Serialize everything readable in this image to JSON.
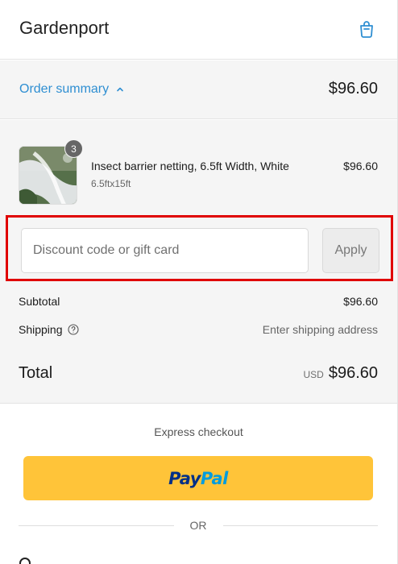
{
  "header": {
    "brand": "Gardenport",
    "cart_icon": "shopping-bag-icon"
  },
  "summary": {
    "toggle_label": "Order summary",
    "toggle_icon": "chevron-up-icon",
    "total": "$96.60"
  },
  "item": {
    "name": "Insect barrier netting, 6.5ft Width, White",
    "variant": "6.5ftx15ft",
    "price": "$96.60",
    "quantity": "3",
    "image_icon": "product-thumbnail"
  },
  "discount": {
    "placeholder": "Discount code or gift card",
    "value": "",
    "apply_label": "Apply"
  },
  "totals": {
    "subtotal_label": "Subtotal",
    "subtotal_value": "$96.60",
    "shipping_label": "Shipping",
    "shipping_value": "Enter shipping address",
    "total_label": "Total",
    "currency": "USD",
    "total_value": "$96.60"
  },
  "express": {
    "label": "Express checkout",
    "paypal_part1": "Pay",
    "paypal_part2": "Pal",
    "or_label": "OR"
  },
  "colors": {
    "accent": "#2f8fd2",
    "paypal_button": "#ffc439",
    "highlight_box": "#e00000"
  }
}
